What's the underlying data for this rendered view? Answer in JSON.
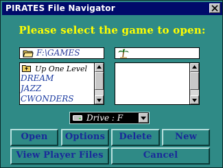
{
  "window": {
    "title": "PIRATES File Navigator",
    "close_glyph": "×"
  },
  "heading": "Please select the game to open:",
  "path_field": {
    "value": "F:\\GAMES",
    "icon": "folder-open-icon"
  },
  "directory_list": {
    "items": [
      {
        "label": "Up One Level",
        "icon": "folder-up-icon"
      },
      {
        "label": "DREAM"
      },
      {
        "label": "JAZZ"
      },
      {
        "label": "CWONDERS"
      }
    ]
  },
  "file_field": {
    "value": "",
    "icon": "palm-tree-icon"
  },
  "file_list": {
    "items": []
  },
  "drive_select": {
    "value": "Drive : F",
    "icon": "drive-icon"
  },
  "buttons": {
    "open": "Open",
    "options": "Options",
    "delete": "Delete",
    "new": "New",
    "view_player_files": "View Player Files",
    "cancel": "Cancel"
  },
  "colors": {
    "background": "#2f8a86",
    "titlebar": "#000a6a",
    "heading": "#ffff00",
    "button_text": "#1a2a9a",
    "list_text": "#1a3aa0"
  }
}
